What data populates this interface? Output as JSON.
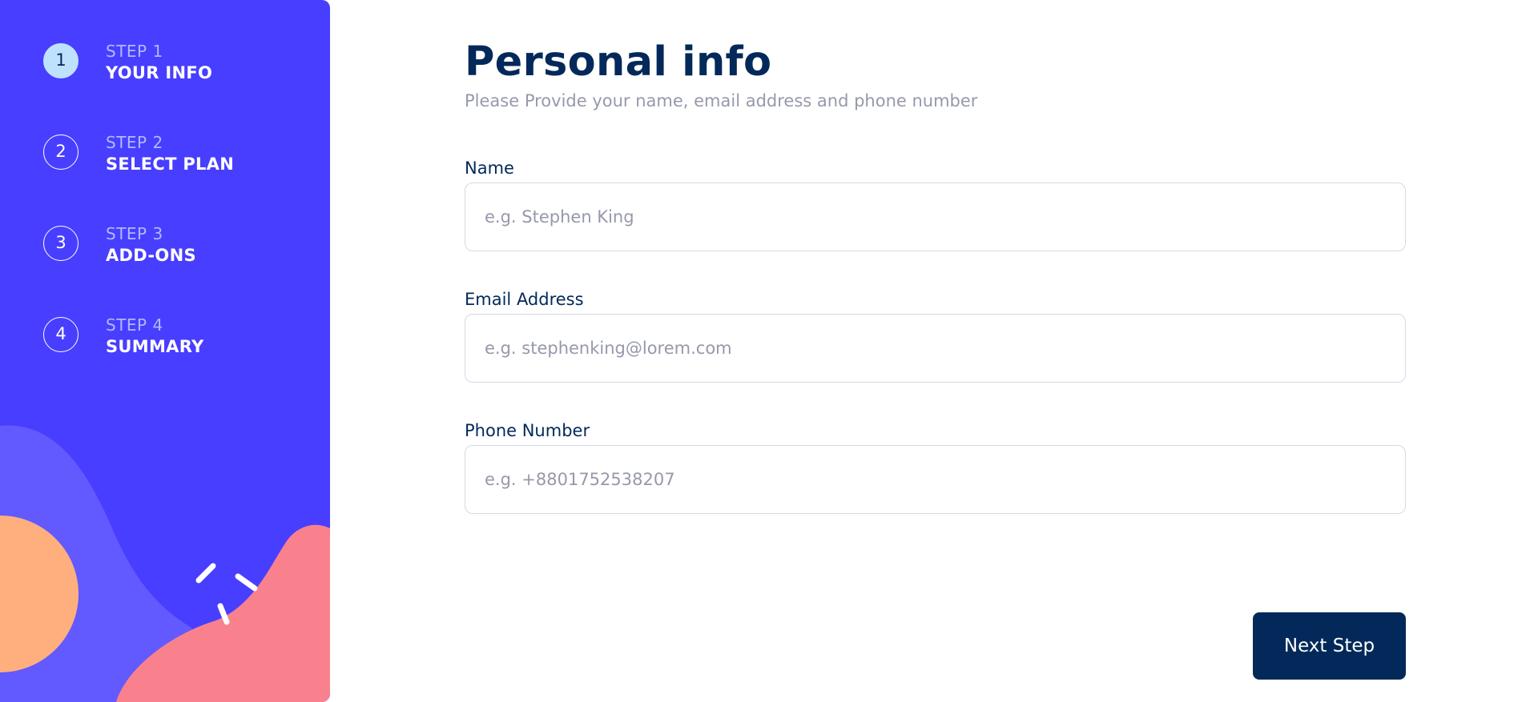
{
  "sidebar": {
    "steps": [
      {
        "number": "1",
        "label": "STEP 1",
        "title": "YOUR INFO",
        "active": true
      },
      {
        "number": "2",
        "label": "STEP 2",
        "title": "SELECT PLAN",
        "active": false
      },
      {
        "number": "3",
        "label": "STEP 3",
        "title": "ADD-ONS",
        "active": false
      },
      {
        "number": "4",
        "label": "STEP 4",
        "title": "SUMMARY",
        "active": false
      }
    ]
  },
  "main": {
    "title": "Personal info",
    "subtitle": "Please Provide your name, email address and phone number",
    "fields": {
      "name": {
        "label": "Name",
        "placeholder": "e.g. Stephen King",
        "value": ""
      },
      "email": {
        "label": "Email Address",
        "placeholder": "e.g. stephenking@lorem.com",
        "value": ""
      },
      "phone": {
        "label": "Phone Number",
        "placeholder": "e.g. +8801752538207",
        "value": ""
      }
    },
    "next_label": "Next Step"
  },
  "colors": {
    "sidebar_bg": "#483eff",
    "active_step_bg": "#bee2fd",
    "primary_dark": "#02295a",
    "muted_text": "#9699ab",
    "input_border": "#d6d9e6",
    "blob_orange": "#ffaf7e",
    "blob_pink": "#f9818e",
    "blob_lavender": "#6259ff"
  }
}
